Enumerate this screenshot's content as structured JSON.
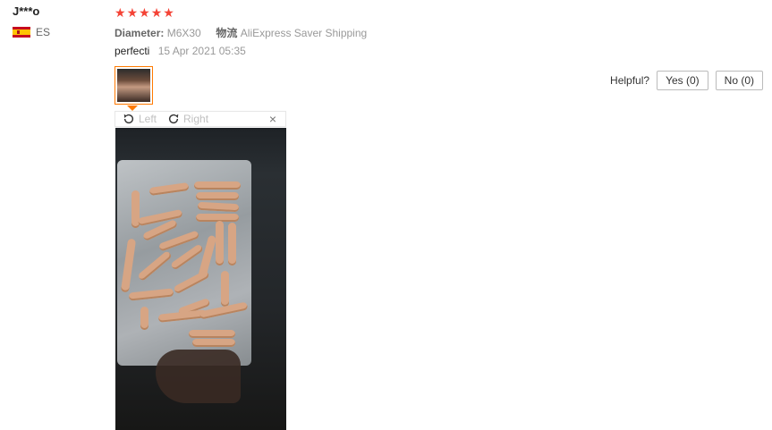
{
  "reviewer": {
    "name": "J***o",
    "country": "ES"
  },
  "rating": {
    "stars": 5
  },
  "attributes": {
    "key1": "Diameter:",
    "val1": "M6X30",
    "key2": "物流",
    "val2": "AliExpress Saver Shipping"
  },
  "feedback": {
    "text": "perfecti",
    "date": "15 Apr 2021 05:35"
  },
  "helpful": {
    "label": "Helpful?",
    "yes": "Yes (0)",
    "no": "No (0)"
  },
  "viewer": {
    "left": "Left",
    "right": "Right",
    "close": "×"
  },
  "icons": [
    "star-icon",
    "rotate-left-icon",
    "rotate-right-icon",
    "close-icon",
    "spain-flag-icon"
  ],
  "colors": {
    "star": "#f44336",
    "thumb_border": "#ff7a00"
  }
}
